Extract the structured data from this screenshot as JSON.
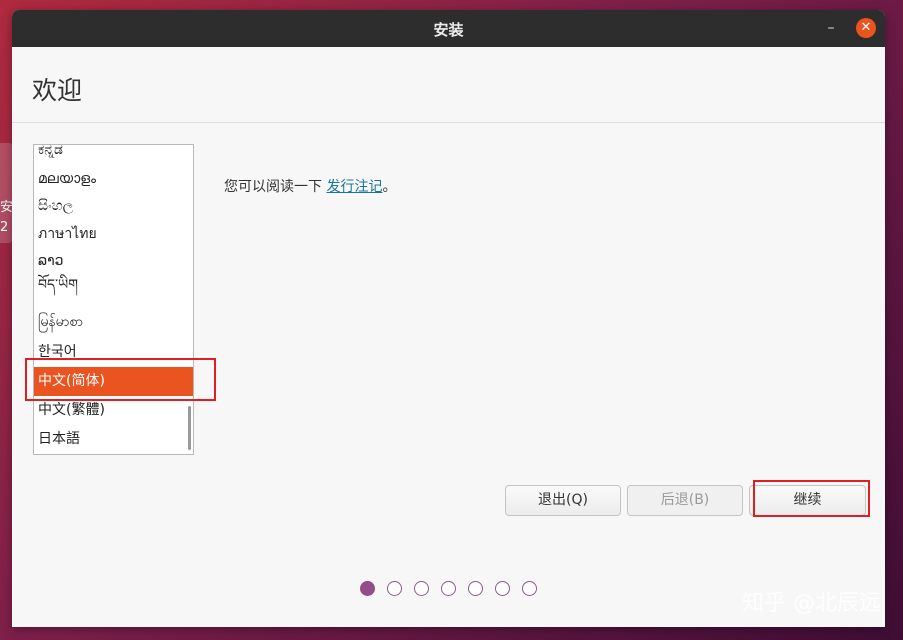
{
  "desktop": {
    "icon_label_lines": [
      "安",
      "2"
    ]
  },
  "window": {
    "title": "安装"
  },
  "page": {
    "heading": "欢迎"
  },
  "languages": {
    "items": [
      "ಕನ್ನಡ",
      "മലയാളം",
      "සිංහල",
      "ภาษาไทย",
      "ລາວ",
      "བོད་ཡིག",
      "မြန်မာစာ",
      "한국어",
      "中文(简体)",
      "中文(繁體)",
      "日本語"
    ],
    "selected": "中文(简体)"
  },
  "notes": {
    "prefix": "您可以阅读一下 ",
    "link_label": "发行注记",
    "suffix": "。"
  },
  "buttons": {
    "quit_label": "退出(Q)",
    "back_label": "后退(B)",
    "continue_label": "继续"
  },
  "progress": {
    "total_steps": 7,
    "current_step": 1
  },
  "colors": {
    "accent": "#e95420",
    "titlebar": "#2d2d2d",
    "progress_dot": "#924d8b",
    "link": "#19759c",
    "highlight_box": "#e02020"
  },
  "watermark": {
    "text": "知乎 @北辰远"
  }
}
